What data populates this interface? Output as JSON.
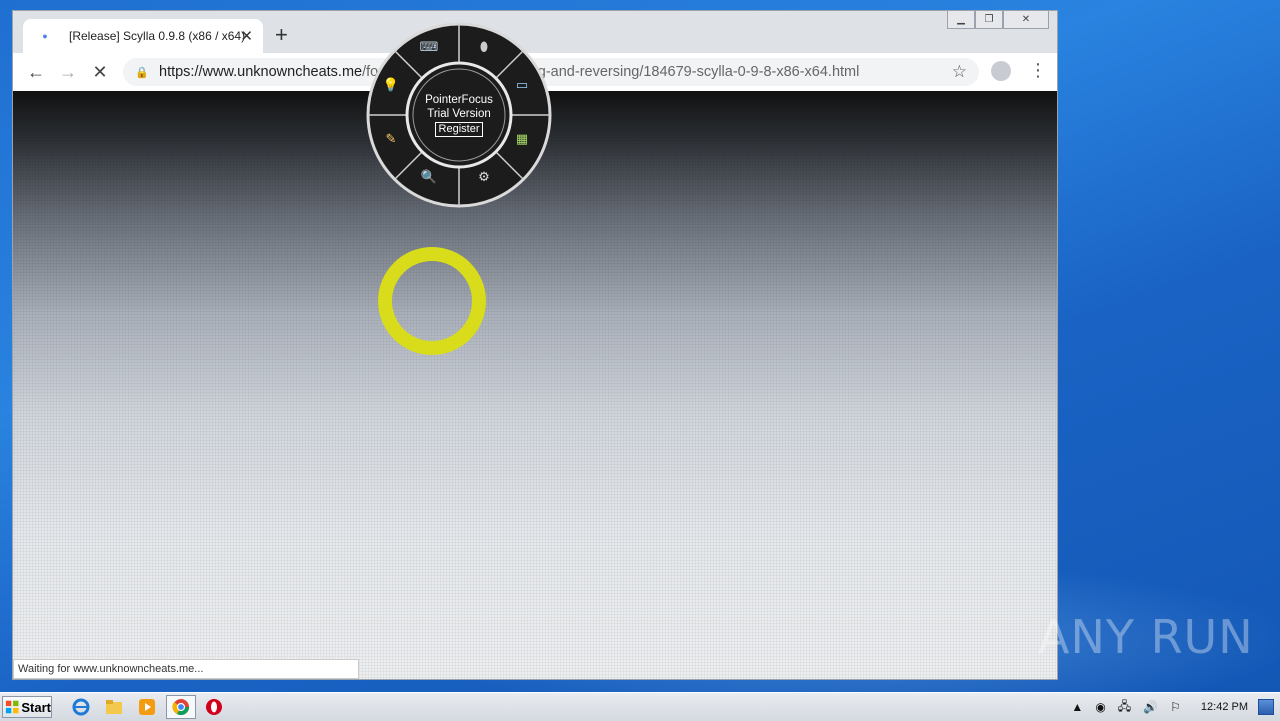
{
  "browser": {
    "tab_title": "[Release] Scylla 0.9.8 (x86 / x64)",
    "tab_close": "✕",
    "new_tab": "+",
    "url_host": "https://www.unknowncheats.me",
    "url_path": "/forum/general-programming-and-reversing/184679-scylla-0-9-8-x86-x64.html",
    "status_text": "Waiting for www.unknowncheats.me...",
    "loading": true
  },
  "window_controls": {
    "minimize": "▁",
    "restore": "❐",
    "close": "✕"
  },
  "pointerfocus": {
    "name": "PointerFocus",
    "edition": "Trial Version",
    "register_label": "Register",
    "focus_ring_color": "#d8dc1a"
  },
  "taskbar": {
    "start_label": "Start",
    "clock": "12:42 PM"
  },
  "watermark": {
    "text": "ANY RUN"
  },
  "colors": {
    "desktop": "#1f6fd0",
    "tab_bg": "#dee1e6",
    "omnibox_bg": "#f1f3f4"
  }
}
